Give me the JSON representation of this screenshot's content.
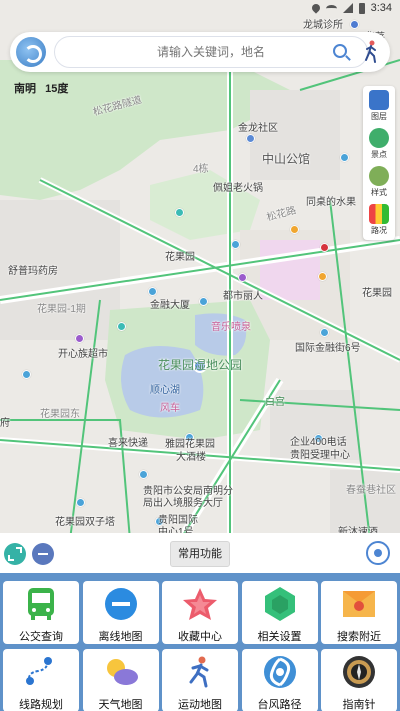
{
  "status_bar": {
    "time": "3:34"
  },
  "search": {
    "placeholder": "请输入关键词，地名"
  },
  "city": {
    "name": "南明",
    "temperature": "15度"
  },
  "right_tools": [
    {
      "label": "图层"
    },
    {
      "label": "景点"
    },
    {
      "label": "样式"
    },
    {
      "label": "路况"
    }
  ],
  "map_labels": {
    "l1": "龙城诊所",
    "l2": "华莱",
    "l3": "松花路隧道",
    "l4": "金龙社区",
    "l5": "中山公馆",
    "l6": "4栋",
    "l7": "佩姐老火锅",
    "l8": "同桌的水果",
    "l9": "松花路",
    "l10": "舒普玛药房",
    "l11": "花果园",
    "l12": "金融大厦",
    "l13": "都市丽人",
    "l14": "花果园-1期",
    "l15": "开心族超市",
    "l16": "音乐喷泉",
    "l17": "花果园湿地公园",
    "l18": "国际金融街6号",
    "l19": "顺心湖",
    "l20": "风车",
    "l21": "白宫",
    "l22": "花果园东",
    "l23": "喜来快递",
    "l24": "雅园花果园",
    "l25": "大酒楼",
    "l26": "企业400电话",
    "l27": "贵阳受理中心",
    "l28": "贵阳市公安局南明分",
    "l29": "局出入境服务大厅",
    "l30": "春蚕巷社区",
    "l31": "花果园双子塔",
    "l32": "贵阳国际",
    "l33": "中心1号",
    "l34": "花果园",
    "l35": "府",
    "l36": "新沐速酒"
  },
  "controls": {
    "common_functions": "常用功能"
  },
  "grid": [
    {
      "label": "公交查询",
      "icon": "bus-icon"
    },
    {
      "label": "离线地图",
      "icon": "offline-map-icon"
    },
    {
      "label": "收藏中心",
      "icon": "star-icon"
    },
    {
      "label": "相关设置",
      "icon": "settings-gem-icon"
    },
    {
      "label": "搜索附近",
      "icon": "nearby-search-icon"
    },
    {
      "label": "线路规划",
      "icon": "route-icon"
    },
    {
      "label": "天气地图",
      "icon": "weather-icon"
    },
    {
      "label": "运动地图",
      "icon": "runner-icon"
    },
    {
      "label": "台风路径",
      "icon": "typhoon-icon"
    },
    {
      "label": "指南针",
      "icon": "compass-icon"
    }
  ]
}
